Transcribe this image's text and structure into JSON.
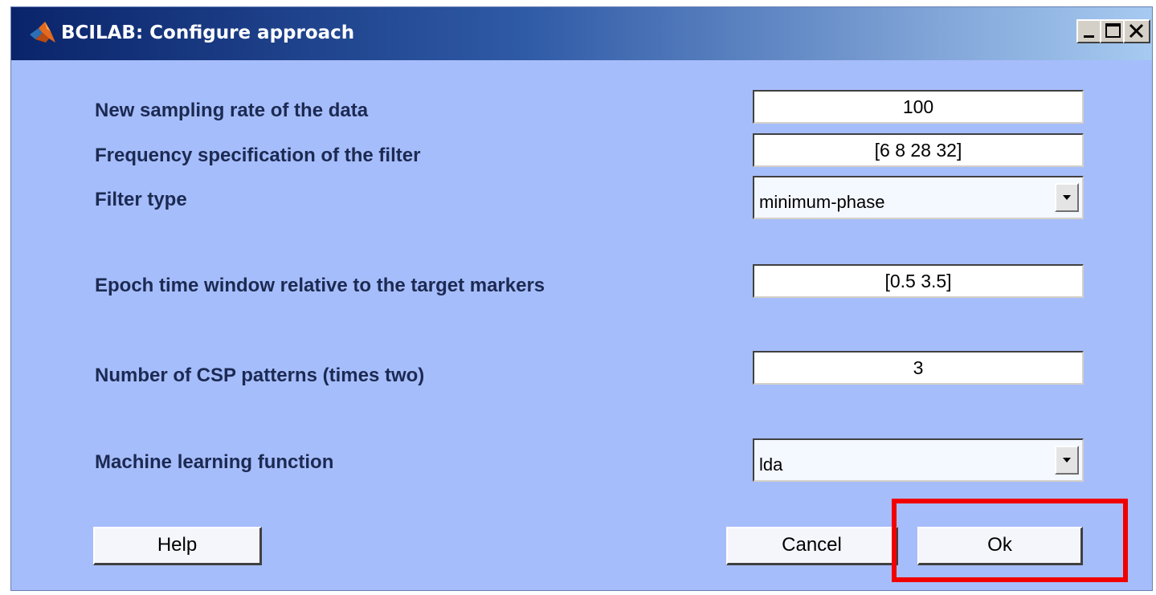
{
  "window": {
    "title": "BCILAB: Configure approach",
    "controls": [
      "minimize-icon",
      "maximize-icon",
      "close-icon"
    ]
  },
  "form": {
    "sampling_rate": {
      "label": "New sampling rate of the data",
      "value": "100"
    },
    "frequency_spec": {
      "label": "Frequency specification of the filter",
      "value": "[6 8 28 32]"
    },
    "filter_type": {
      "label": "Filter type",
      "value": "minimum-phase"
    },
    "epoch_window": {
      "label": "Epoch time window relative to the target markers",
      "value": "[0.5 3.5]"
    },
    "csp_patterns": {
      "label": "Number of CSP patterns (times two)",
      "value": "3"
    },
    "ml_function": {
      "label": "Machine learning function",
      "value": "lda"
    }
  },
  "buttons": {
    "help": "Help",
    "cancel": "Cancel",
    "ok": "Ok"
  },
  "colors": {
    "dialog_background": "#a6bdfb",
    "highlight": "#f00000"
  }
}
